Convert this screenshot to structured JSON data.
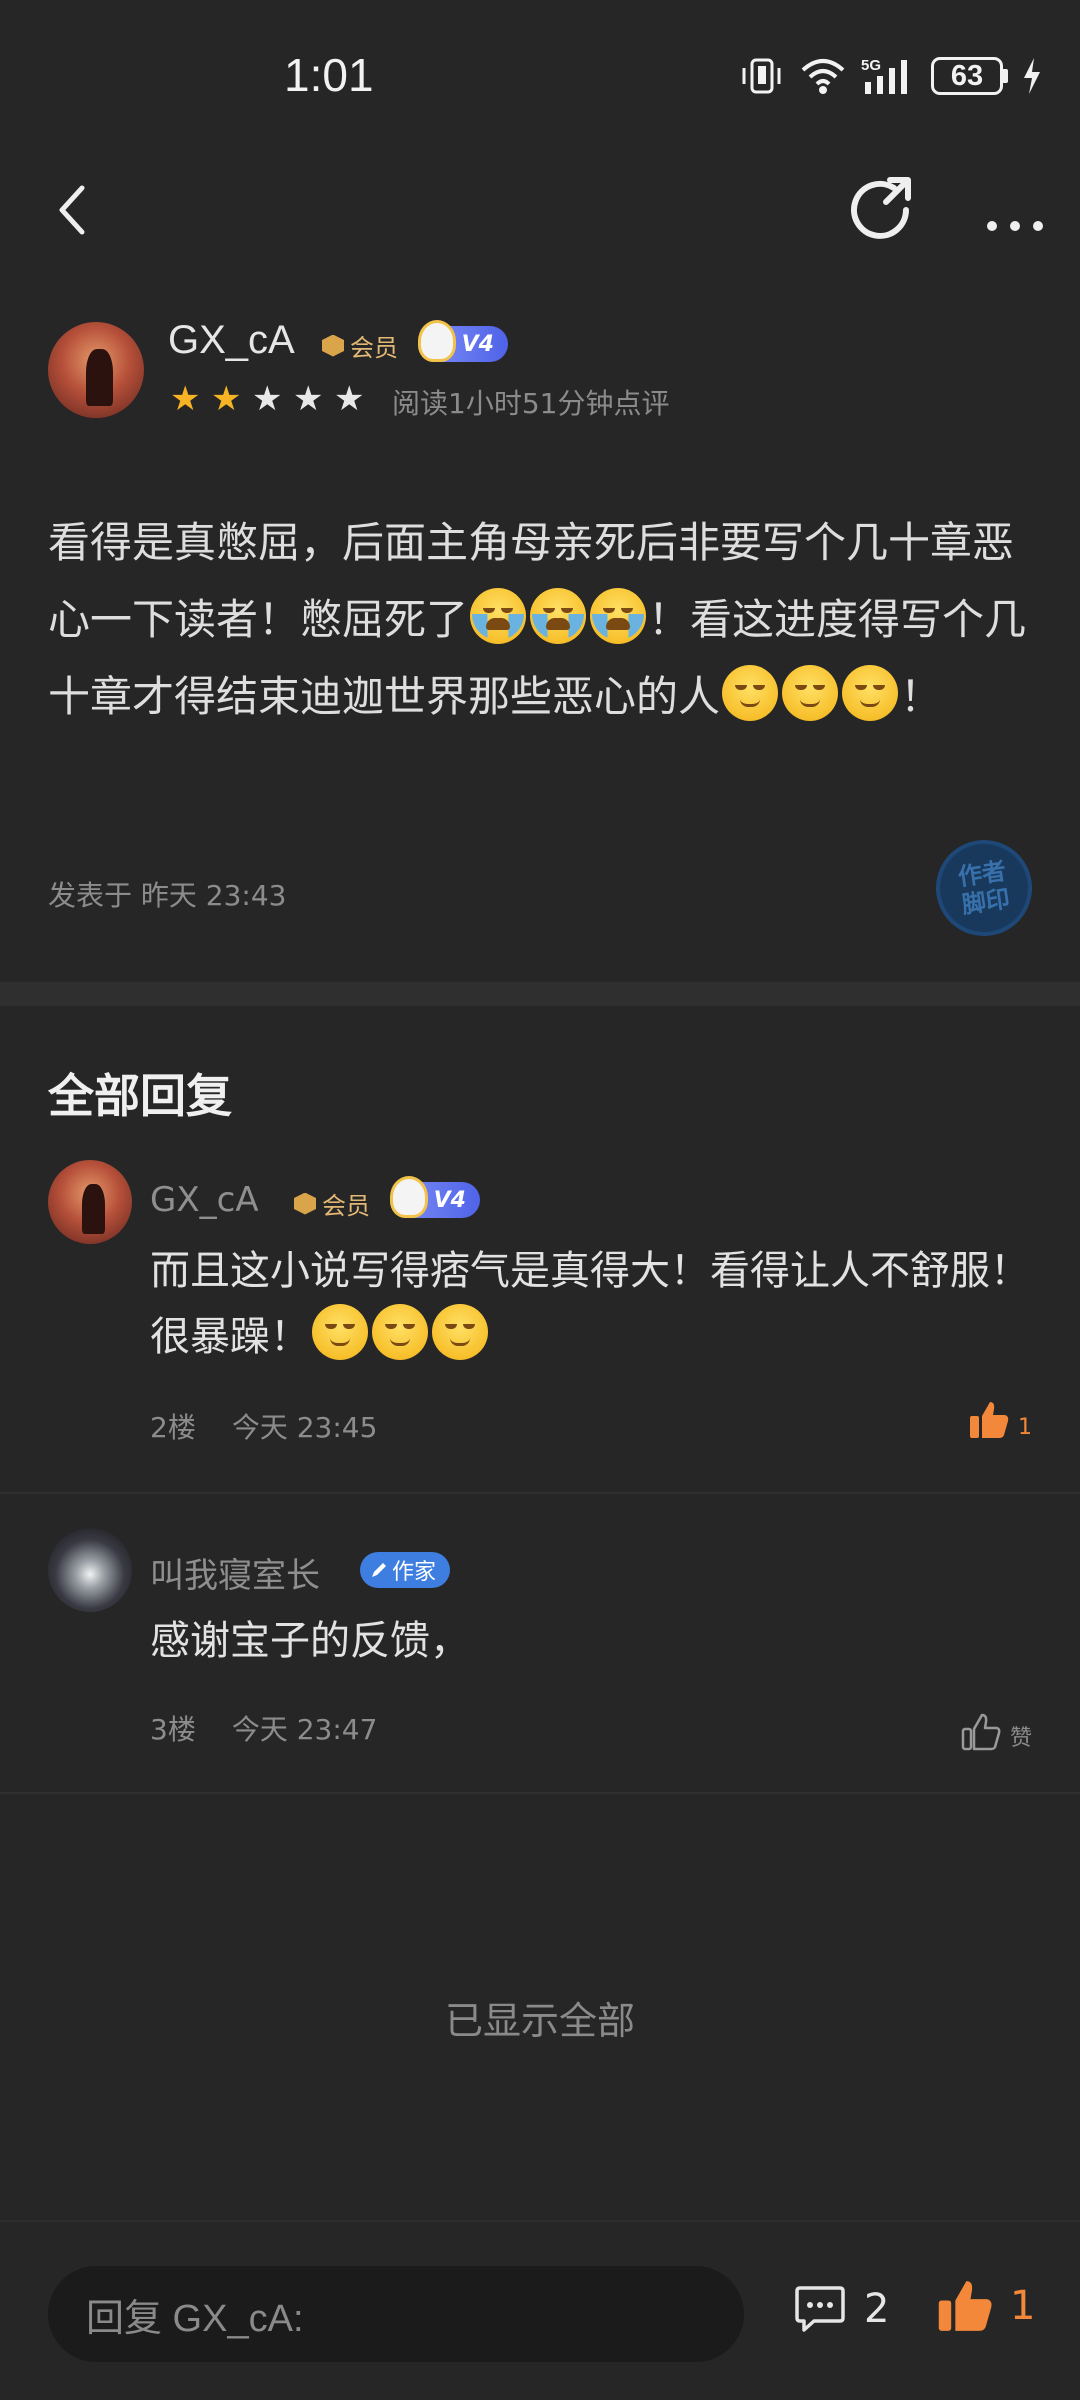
{
  "status_bar": {
    "time": "1:01",
    "battery": "63",
    "network": "5G"
  },
  "post": {
    "user_name": "GX_cA",
    "vip_label": "会员",
    "level_label": "V4",
    "rating": 2,
    "rating_max": 5,
    "read_meta": "阅读1小时51分钟点评",
    "body_segments": [
      "看得是真憋屈，后面主角母亲死后非要写个几十章恶心一下读者！憋屈死了",
      "！看这进度得写个几十章才得结束迪迦世界那些恶心的人",
      "！"
    ],
    "post_time": "发表于 昨天 23:43",
    "stamp_text": "作者脚印"
  },
  "replies_title": "全部回复",
  "replies": [
    {
      "user_name": "GX_cA",
      "vip_label": "会员",
      "level_label": "V4",
      "text": "而且这小说写得痞气是真得大！看得让人不舒服！很暴躁！",
      "floor": "2楼",
      "time": "今天 23:45",
      "like_count": "1"
    },
    {
      "user_name": "叫我寝室长",
      "writer_label": "作家",
      "text": "感谢宝子的反馈，",
      "floor": "3楼",
      "time": "今天 23:47",
      "like_label": "赞"
    }
  ],
  "all_shown": "已显示全部",
  "bottom_bar": {
    "reply_placeholder": "回复 GX_cA:",
    "comment_count": "2",
    "like_count": "1"
  },
  "colors": {
    "background": "#262626",
    "accent_orange": "#f3883a",
    "star": "#f6b323",
    "writer_blue": "#3d7ee0"
  }
}
